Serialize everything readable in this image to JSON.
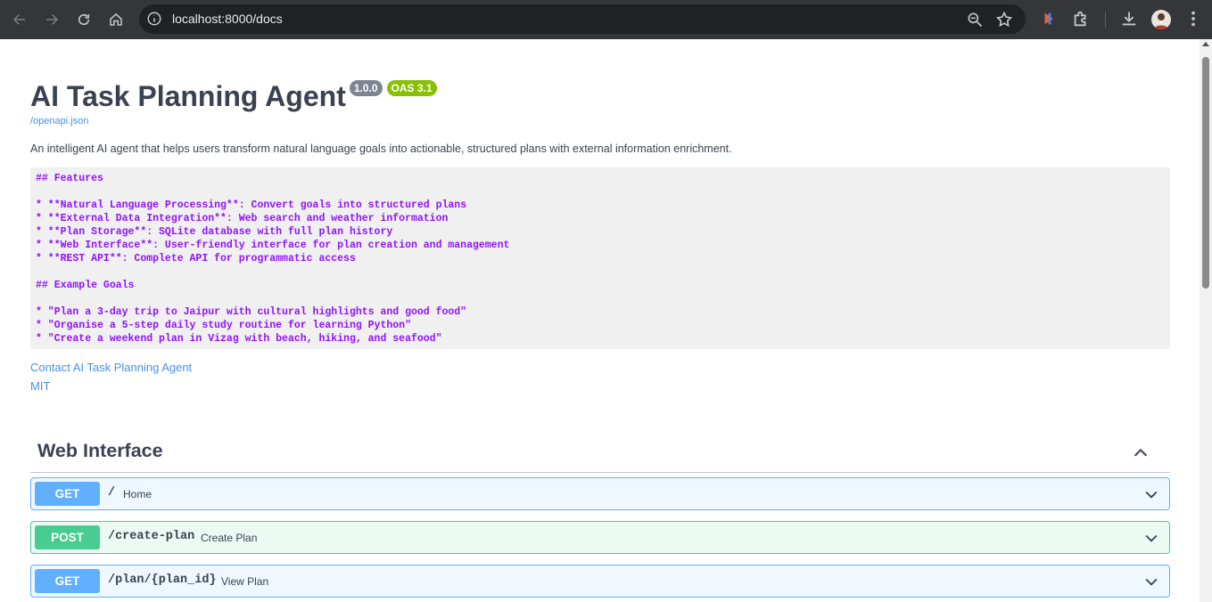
{
  "browser": {
    "url": "localhost:8000/docs"
  },
  "info": {
    "title": "AI Task Planning Agent",
    "version": "1.0.0",
    "oas": "OAS 3.1",
    "spec_link": "/openapi.json",
    "description": "An intelligent AI agent that helps users transform natural language goals into actionable, structured plans with external information enrichment.",
    "code_lines": [
      "## Features",
      "",
      "* **Natural Language Processing**: Convert goals into structured plans",
      "* **External Data Integration**: Web search and weather information",
      "* **Plan Storage**: SQLite database with full plan history",
      "* **Web Interface**: User-friendly interface for plan creation and management",
      "* **REST API**: Complete API for programmatic access",
      "",
      "## Example Goals",
      "",
      "* \"Plan a 3-day trip to Jaipur with cultural highlights and good food\"",
      "* \"Organise a 5-step daily study routine for learning Python\"",
      "* \"Create a weekend plan in Vizag with beach, hiking, and seafood\""
    ],
    "contact": "Contact AI Task Planning Agent",
    "license": "MIT"
  },
  "tag": {
    "name": "Web Interface"
  },
  "operations": [
    {
      "method": "GET",
      "path": "/",
      "summary": "Home"
    },
    {
      "method": "POST",
      "path": "/create-plan",
      "summary": "Create Plan"
    },
    {
      "method": "GET",
      "path": "/plan/{plan_id}",
      "summary": "View Plan"
    }
  ],
  "colors": {
    "get": "#61affe",
    "post": "#49cc90",
    "link": "#4990e2",
    "code_text": "#9012fe",
    "title": "#3b4151"
  }
}
